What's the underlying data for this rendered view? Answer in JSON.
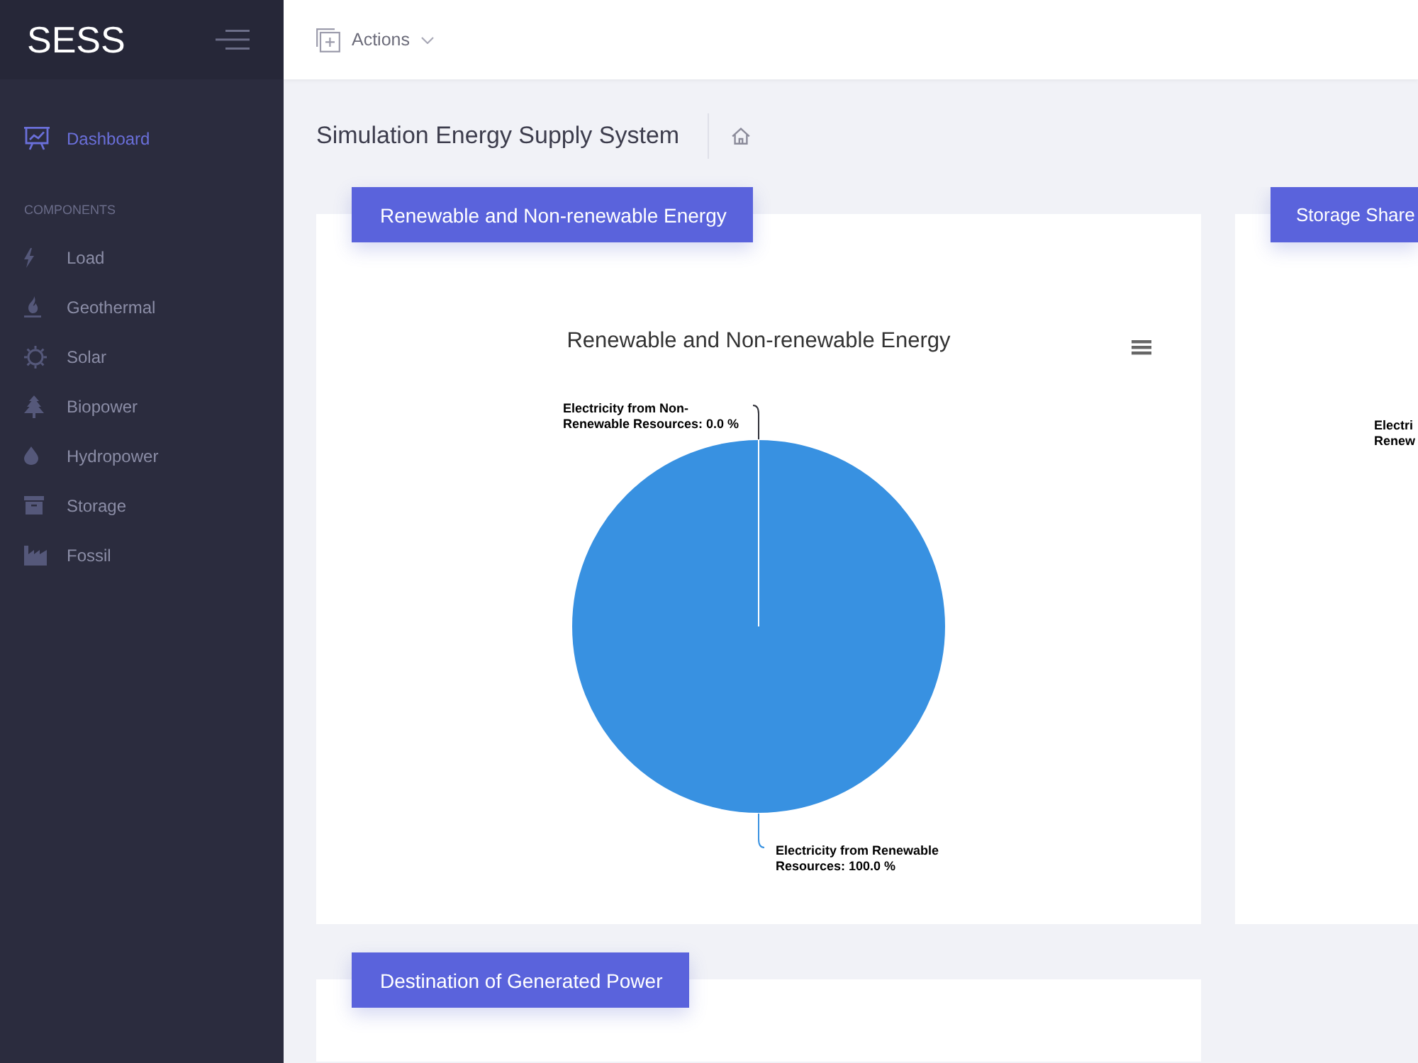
{
  "sidebar": {
    "logo": "SESS",
    "nav": [
      {
        "label": "Dashboard",
        "selected": true
      }
    ],
    "section_title": "COMPONENTS",
    "items": [
      {
        "label": "Load",
        "selected": false
      },
      {
        "label": "Geothermal",
        "selected": false
      },
      {
        "label": "Solar",
        "selected": false
      },
      {
        "label": "Biopower",
        "selected": false
      },
      {
        "label": "Hydropower",
        "selected": false
      },
      {
        "label": "Storage",
        "selected": false
      },
      {
        "label": "Fossil",
        "selected": false
      }
    ]
  },
  "topbar": {
    "actions": "Actions"
  },
  "page": {
    "title": "Simulation Energy Supply System"
  },
  "cards": [
    {
      "label": "Renewable and Non-renewable Energy",
      "chart_data": {
        "type": "pie",
        "title": "Renewable and Non-renewable Energy",
        "values": [
          0.0,
          100.0
        ],
        "data_labels": true,
        "value_labels": [
          "Electricity from Non-Renewable Resources: 0.0 %",
          "Electricity from Renewable Resources: 100.0 %"
        ]
      }
    },
    {
      "label": "Storage Share",
      "data_label_fragments": [
        "Electri",
        "Renew"
      ]
    },
    {
      "label": "Destination of Generated Power"
    }
  ]
}
